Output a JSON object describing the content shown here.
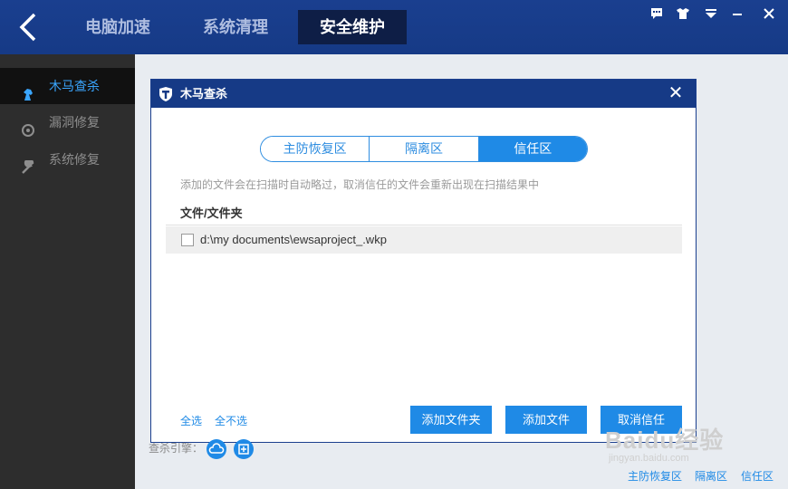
{
  "topbar": {
    "tabs": [
      "电脑加速",
      "系统清理",
      "安全维护"
    ],
    "active_tab": "安全维护"
  },
  "window_controls": [
    "feedback-icon",
    "skin-icon",
    "menu-icon",
    "minimize-icon"
  ],
  "sidebar": {
    "items": [
      {
        "label": "木马查杀",
        "icon": "horse-icon",
        "active": true
      },
      {
        "label": "漏洞修复",
        "icon": "patch-icon",
        "active": false
      },
      {
        "label": "系统修复",
        "icon": "wrench-icon",
        "active": false
      }
    ]
  },
  "dialog": {
    "title": "木马查杀",
    "segments": [
      {
        "label": "主防恢复区",
        "active": false
      },
      {
        "label": "隔离区",
        "active": false
      },
      {
        "label": "信任区",
        "active": true
      }
    ],
    "hint": "添加的文件会在扫描时自动略过，取消信任的文件会重新出现在扫描结果中",
    "column_header": "文件/文件夹",
    "files": [
      {
        "path": "d:\\my documents\\ewsaproject_.wkp",
        "checked": false
      }
    ],
    "select_all": "全选",
    "select_none": "全不选",
    "buttons": {
      "add_folder": "添加文件夹",
      "add_file": "添加文件",
      "untrust": "取消信任"
    }
  },
  "bottom": {
    "engine_label": "查杀引擎：",
    "links": [
      "主防恢复区",
      "隔离区",
      "信任区"
    ]
  },
  "watermark": {
    "text": "Baidu经验",
    "url": "jingyan.baidu.com"
  },
  "colors": {
    "topbar": "#163a86",
    "accent": "#1f8ae6",
    "sidebar": "#2d2d2d"
  }
}
